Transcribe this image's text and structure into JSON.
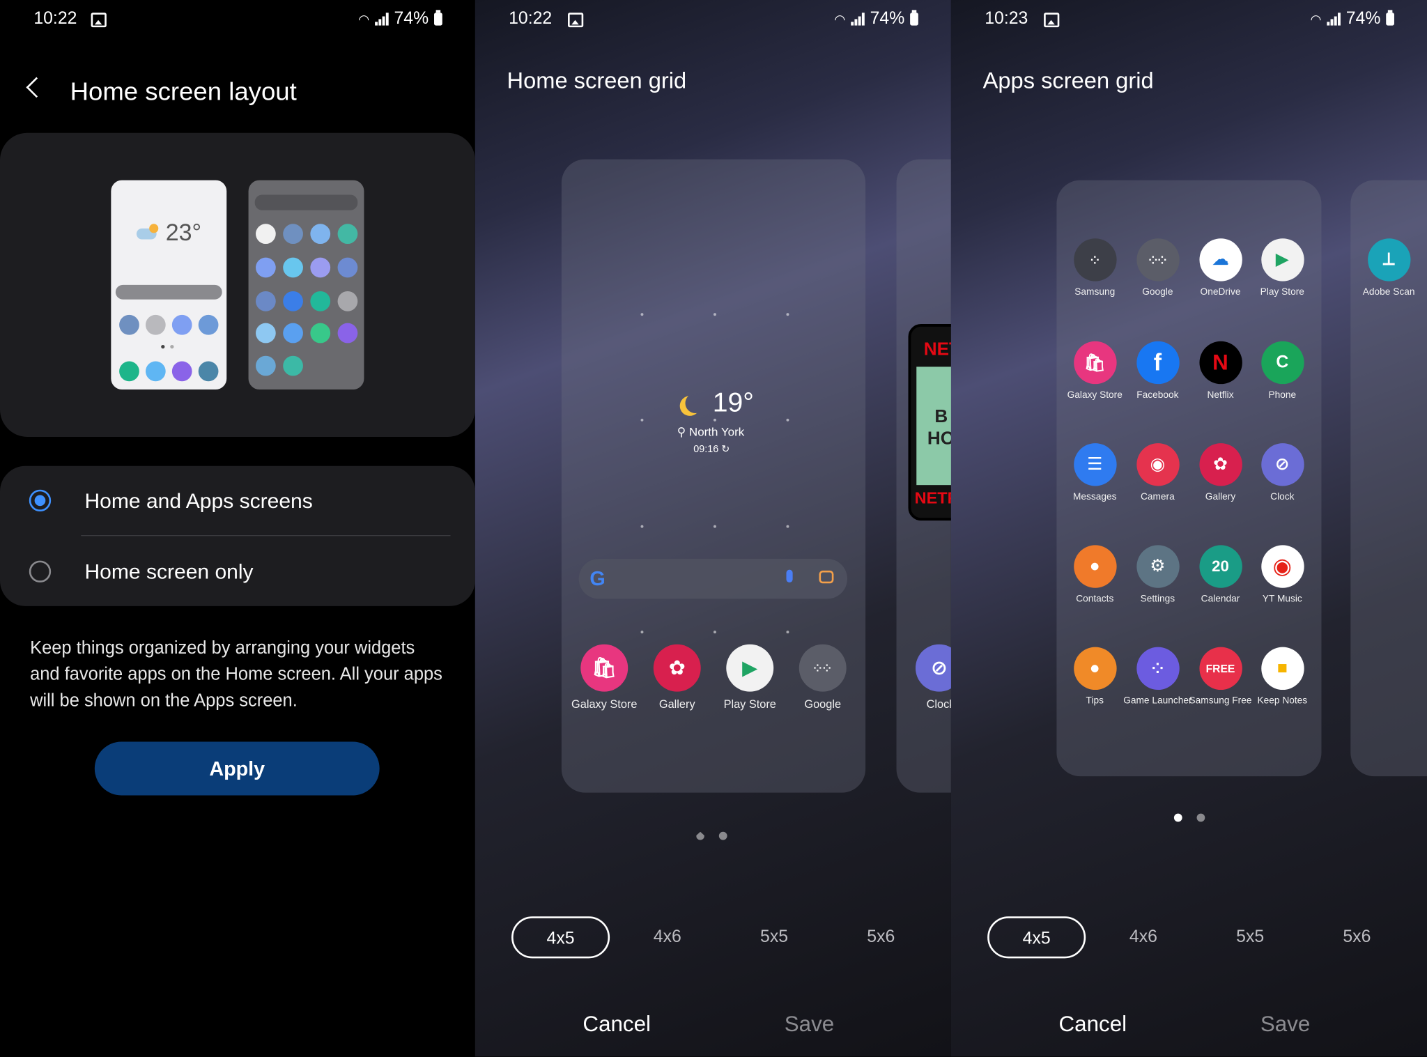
{
  "screens": [
    {
      "status": {
        "time": "10:22",
        "battery": "74%"
      },
      "title": "Home screen layout",
      "preview": {
        "weather_temp": "23°"
      },
      "options": [
        {
          "label": "Home and Apps screens",
          "selected": true
        },
        {
          "label": "Home screen only",
          "selected": false
        }
      ],
      "description": "Keep things organized by arranging your widgets and favorite apps on the Home screen. All your apps will be shown on the Apps screen.",
      "apply_label": "Apply"
    },
    {
      "status": {
        "time": "10:22",
        "battery": "74%"
      },
      "title": "Home screen grid",
      "weather": {
        "temp": "19°",
        "location": "North York",
        "time": "09:16"
      },
      "search_g": "G",
      "dock": [
        {
          "label": "Galaxy Store",
          "icon": "galaxy-store-icon",
          "color": "#e8367f"
        },
        {
          "label": "Gallery",
          "icon": "gallery-icon",
          "color": "#d8204e"
        },
        {
          "label": "Play Store",
          "icon": "play-store-icon",
          "color": "#f2f2f2"
        },
        {
          "label": "Google",
          "icon": "google-folder-icon",
          "color": "#5b5d68"
        }
      ],
      "peek_app": {
        "label": "Clock",
        "icon": "clock-icon"
      },
      "netflix_text": [
        "NET",
        "B",
        "HO",
        "NETF"
      ],
      "grid_options": [
        "4x5",
        "4x6",
        "5x5",
        "5x6"
      ],
      "selected_grid": "4x5",
      "cancel_label": "Cancel",
      "save_label": "Save"
    },
    {
      "status": {
        "time": "10:23",
        "battery": "74%"
      },
      "title": "Apps screen grid",
      "apps": [
        {
          "label": "Samsung",
          "icon": "samsung-folder-icon",
          "color": "#3d3f48"
        },
        {
          "label": "Google",
          "icon": "google-folder-icon",
          "color": "#5b5d68"
        },
        {
          "label": "OneDrive",
          "icon": "onedrive-icon",
          "color": "#ffffff"
        },
        {
          "label": "Play Store",
          "icon": "play-store-icon",
          "color": "#f2f2f2"
        },
        {
          "label": "Galaxy Store",
          "icon": "galaxy-store-icon",
          "color": "#e8367f"
        },
        {
          "label": "Facebook",
          "icon": "facebook-icon",
          "color": "#1877f2"
        },
        {
          "label": "Netflix",
          "icon": "netflix-icon",
          "color": "#000000"
        },
        {
          "label": "Phone",
          "icon": "phone-icon",
          "color": "#1aa55a"
        },
        {
          "label": "Messages",
          "icon": "messages-icon",
          "color": "#2f7bf0"
        },
        {
          "label": "Camera",
          "icon": "camera-icon",
          "color": "#e5334e"
        },
        {
          "label": "Gallery",
          "icon": "gallery-icon",
          "color": "#d8204e"
        },
        {
          "label": "Clock",
          "icon": "clock-icon",
          "color": "#6b6dd6"
        },
        {
          "label": "Contacts",
          "icon": "contacts-icon",
          "color": "#f07a2a"
        },
        {
          "label": "Settings",
          "icon": "settings-icon",
          "color": "#5d7484"
        },
        {
          "label": "Calendar",
          "icon": "calendar-icon",
          "color": "#1a9c86"
        },
        {
          "label": "YT Music",
          "icon": "yt-music-icon",
          "color": "#ffffff"
        },
        {
          "label": "Tips",
          "icon": "tips-icon",
          "color": "#f08a28"
        },
        {
          "label": "Game Launcher",
          "icon": "game-launcher-icon",
          "color": "#6c5ce0"
        },
        {
          "label": "Samsung Free",
          "icon": "samsung-free-icon",
          "color": "#e8304a"
        },
        {
          "label": "Keep Notes",
          "icon": "keep-notes-icon",
          "color": "#ffffff"
        }
      ],
      "calendar_day": "20",
      "netflix_letter": "N",
      "phone_letter": "C",
      "free_text": "FREE",
      "peek_app": {
        "label": "Adobe Scan",
        "icon": "adobe-scan-icon"
      },
      "grid_options": [
        "4x5",
        "4x6",
        "5x5",
        "5x6"
      ],
      "selected_grid": "4x5",
      "cancel_label": "Cancel",
      "save_label": "Save"
    }
  ]
}
